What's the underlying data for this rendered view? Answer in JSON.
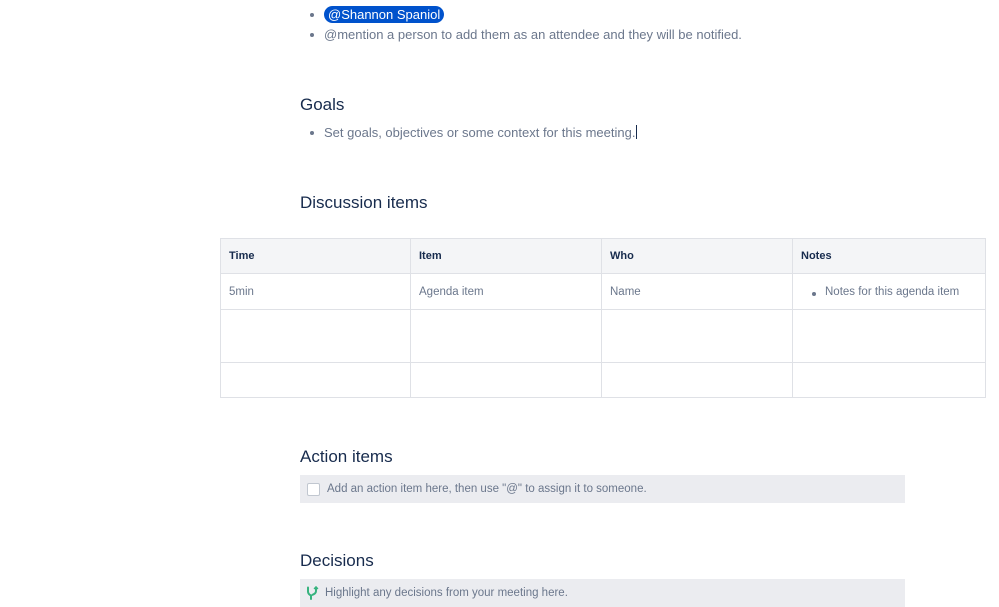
{
  "attendees": {
    "mention": "@Shannon Spaniol",
    "hint": "@mention a person to add them as an attendee and they will be notified."
  },
  "goals": {
    "heading": "Goals",
    "item": "Set goals, objectives or some context for this meeting."
  },
  "discussion": {
    "heading": "Discussion items",
    "columns": [
      "Time",
      "Item",
      "Who",
      "Notes"
    ],
    "rows": [
      {
        "time": "5min",
        "item": "Agenda item",
        "who": "Name",
        "notes": "Notes for this agenda item"
      },
      {
        "time": "",
        "item": "",
        "who": "",
        "notes": ""
      },
      {
        "time": "",
        "item": "",
        "who": "",
        "notes": ""
      }
    ]
  },
  "action_items": {
    "heading": "Action items",
    "placeholder": "Add an action item here, then use \"@\" to assign it to someone."
  },
  "decisions": {
    "heading": "Decisions",
    "placeholder": "Highlight any decisions from your meeting here.",
    "icon": "decision-icon",
    "icon_color": "#36b37e"
  },
  "colors": {
    "mention_bg": "#0052cc",
    "text": "#172b4d",
    "subtle_text": "#6b778c",
    "panel_bg": "#ebecf0"
  }
}
